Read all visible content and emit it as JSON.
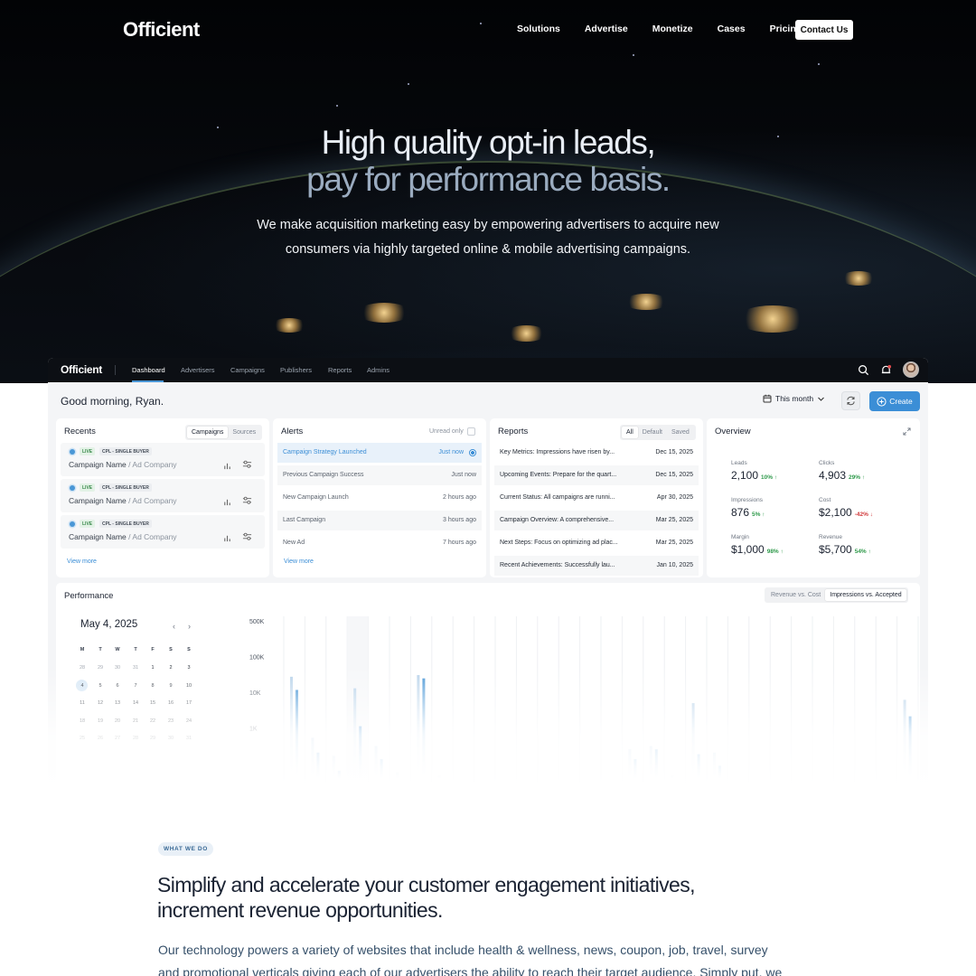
{
  "site": {
    "logo": "Officient",
    "nav": [
      "Solutions",
      "Advertise",
      "Monetize",
      "Cases",
      "Pricing"
    ],
    "cta": "Contact Us",
    "hero": {
      "title_line1": "High quality opt-in leads,",
      "title_line2": "pay for performance basis.",
      "subtitle_line1": "We make acquisition marketing easy by empowering advertisers to acquire new",
      "subtitle_line2": "consumers via highly targeted online & mobile advertising campaigns."
    }
  },
  "app": {
    "logo": "Officient",
    "tabs": [
      "Dashboard",
      "Advertisers",
      "Campaigns",
      "Publishers",
      "Reports",
      "Admins"
    ],
    "active_tab": "Dashboard",
    "greeting": "Good morning, Ryan.",
    "date_range": "This month",
    "create_label": "Create",
    "recents": {
      "title": "Recents",
      "toggle": [
        "Campaigns",
        "Sources"
      ],
      "items": [
        {
          "status": "LIVE",
          "type": "CPL - SINGLE BUYER",
          "name": "Campaign Name",
          "company": "Ad Company"
        },
        {
          "status": "LIVE",
          "type": "CPL - SINGLE BUYER",
          "name": "Campaign Name",
          "company": "Ad Company"
        },
        {
          "status": "LIVE",
          "type": "CPL - SINGLE BUYER",
          "name": "Campaign Name",
          "company": "Ad Company"
        }
      ],
      "view_more": "View more"
    },
    "alerts": {
      "title": "Alerts",
      "unread_label": "Unread only",
      "items": [
        {
          "text": "Campaign Strategy Launched",
          "time": "Just now"
        },
        {
          "text": "Previous Campaign Success",
          "time": "Just now"
        },
        {
          "text": "New Campaign Launch",
          "time": "2 hours ago"
        },
        {
          "text": "Last Campaign",
          "time": "3 hours ago"
        },
        {
          "text": "New Ad",
          "time": "7 hours ago"
        }
      ],
      "view_more": "View more"
    },
    "reports": {
      "title": "Reports",
      "toggle": [
        "All",
        "Default",
        "Saved"
      ],
      "items": [
        {
          "text": "Key Metrics: Impressions have risen by...",
          "date": "Dec 15, 2025"
        },
        {
          "text": "Upcoming Events: Prepare for the quart...",
          "date": "Dec 15, 2025"
        },
        {
          "text": "Current Status: All campaigns are runni...",
          "date": "Apr 30, 2025"
        },
        {
          "text": "Campaign Overview: A comprehensive...",
          "date": "Mar 25, 2025"
        },
        {
          "text": "Next Steps: Focus on optimizing ad plac...",
          "date": "Mar 25, 2025"
        },
        {
          "text": "Recent Achievements: Successfully lau...",
          "date": "Jan 10, 2025"
        }
      ]
    },
    "overview": {
      "title": "Overview",
      "metrics": [
        {
          "label": "Leads",
          "value": "2,100",
          "change": "10%",
          "dir": "up"
        },
        {
          "label": "Clicks",
          "value": "4,903",
          "change": "29%",
          "dir": "up"
        },
        {
          "label": "Impressions",
          "value": "876",
          "change": "5%",
          "dir": "up"
        },
        {
          "label": "Cost",
          "value": "$2,100",
          "change": "-42%",
          "dir": "down"
        },
        {
          "label": "Margin",
          "value": "$1,000",
          "change": "98%",
          "dir": "up"
        },
        {
          "label": "Revenue",
          "value": "$5,700",
          "change": "54%",
          "dir": "up"
        }
      ]
    },
    "performance": {
      "title": "Performance",
      "toggle": [
        "Revenue vs. Cost",
        "Impressions vs. Accepted"
      ],
      "calendar": {
        "month": "May 4, 2025",
        "weekdays": [
          "M",
          "T",
          "W",
          "T",
          "F",
          "S",
          "S"
        ],
        "weeks": [
          [
            "28",
            "29",
            "30",
            "31",
            "1",
            "2",
            "3"
          ],
          [
            "4",
            "5",
            "6",
            "7",
            "8",
            "9",
            "10"
          ],
          [
            "11",
            "12",
            "13",
            "14",
            "15",
            "16",
            "17"
          ],
          [
            "18",
            "19",
            "20",
            "21",
            "22",
            "23",
            "24"
          ],
          [
            "25",
            "26",
            "27",
            "28",
            "29",
            "30",
            "31"
          ]
        ],
        "selected": "4"
      }
    }
  },
  "chart_data": {
    "type": "bar",
    "ylabel": "",
    "y_ticks": [
      "500K",
      "100K",
      "10K",
      "1K"
    ],
    "series": [
      {
        "values": [
          0.62,
          0.25,
          0.14,
          0.55,
          0.2,
          0.04,
          0.63,
          0.02,
          0.0,
          0.0,
          0.0,
          0.0,
          0.0,
          0.0,
          0.0,
          0.0,
          0.18,
          0.2,
          0.02,
          0.46,
          0.16,
          0.0,
          0.0,
          0.0,
          0.0,
          0.0,
          0.0,
          0.0,
          0.0,
          0.48
        ]
      },
      {
        "values": [
          0.54,
          0.16,
          0.05,
          0.32,
          0.12,
          0.0,
          0.61,
          0.0,
          0.0,
          0.0,
          0.0,
          0.0,
          0.0,
          0.0,
          0.0,
          0.0,
          0.12,
          0.18,
          0.0,
          0.15,
          0.08,
          0.0,
          0.0,
          0.0,
          0.0,
          0.0,
          0.0,
          0.0,
          0.0,
          0.38
        ]
      }
    ],
    "colors": [
      "#b9d3ea",
      "#4a97d6"
    ]
  },
  "below": {
    "badge": "WHAT WE DO",
    "heading_line1": "Simplify and accelerate your customer engagement initiatives,",
    "heading_line2": "increment revenue opportunities.",
    "paragraph": "Our technology powers a variety of websites that include health & wellness, news, coupon, job, travel, survey and promotional verticals giving each of our advertisers the ability to reach their target audience. Simply put, we allow"
  },
  "colors": {
    "accent": "#3b8ed6",
    "up": "#2f9a4b",
    "down": "#d0393a",
    "hero_bg": "#05080e"
  }
}
